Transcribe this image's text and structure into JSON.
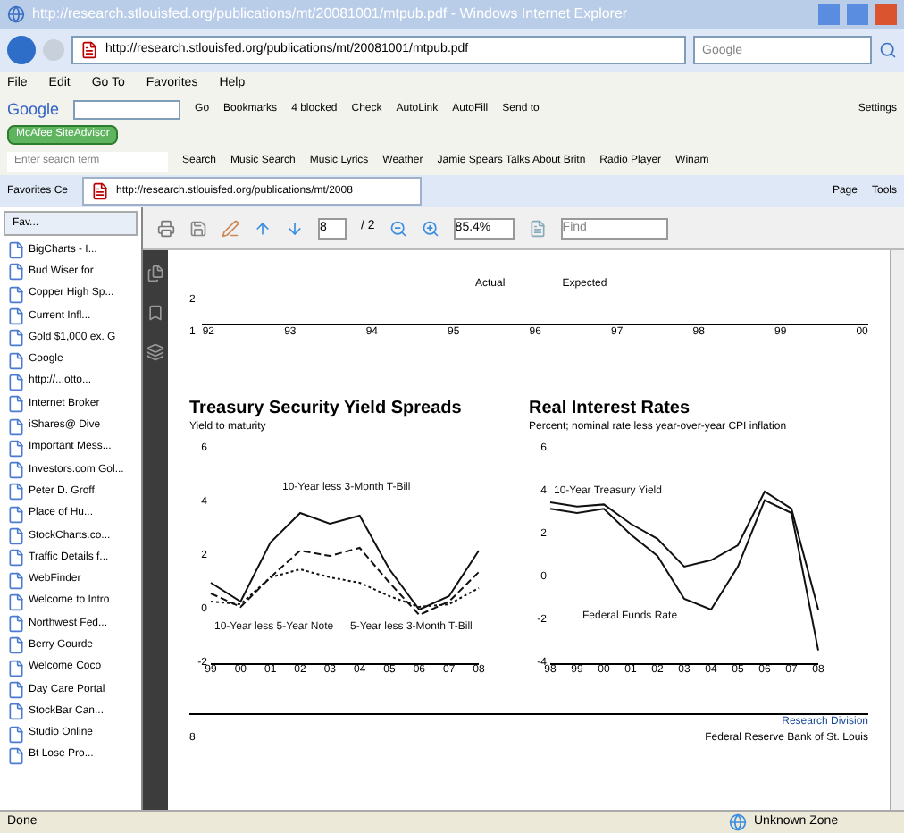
{
  "window": {
    "title": "http://research.stlouisfed.org/publications/mt/20081001/mtpub.pdf - Windows Internet Explorer"
  },
  "address_bar": {
    "url": "http://research.stlouisfed.org/publications/mt/20081001/mtpub.pdf",
    "search_placeholder": "Google"
  },
  "menu": [
    "File",
    "Edit",
    "Go To",
    "Favorites",
    "Help"
  ],
  "google_toolbar": {
    "logo": "Google",
    "items": [
      "Go",
      "Bookmarks",
      "4 blocked",
      "Check",
      "AutoLink",
      "AutoFill",
      "Send to"
    ],
    "right": "Settings"
  },
  "mcafee_button": "McAfee SiteAdvisor",
  "links_toolbar": {
    "search_placeholder": "Enter search term",
    "items": [
      "Search",
      "Music Search",
      "Music Lyrics",
      "Weather",
      "Jamie Spears Talks About Britn",
      "Radio Player"
    ],
    "more": "Winam"
  },
  "tab_bar": {
    "favorites_center": "Favorites Ce",
    "tab_title": "http://research.stlouisfed.org/publications/mt/2008",
    "commands": [
      "Page",
      "Tools"
    ]
  },
  "favorites_pane": {
    "tab": "Fav...",
    "items": [
      "BigCharts - I...",
      "Bud Wiser for",
      "Copper High Sp...",
      "Current Infl...",
      "Gold $1,000 ex. G",
      "Google",
      "http://...otto...",
      "Internet Broker",
      "iShares@ Dive",
      "Important Mess...",
      "Investors.com Gol...",
      "Peter D. Groff",
      "Place of Hu...",
      "StockCharts.co...",
      "Traffic Details f...",
      "WebFinder",
      "Welcome to Intro",
      "Northwest Fed...",
      "Berry Gourde",
      "Welcome Coco",
      "Day Care Portal",
      "StockBar Can...",
      "Studio Online",
      "Bt Lose Pro..."
    ]
  },
  "pdf_toolbar": {
    "page": "8",
    "of": "/ 2",
    "zoom": "85.4%",
    "find_placeholder": "Find"
  },
  "top_chart": {
    "labels": [
      "Actual",
      "Expected"
    ],
    "yticks": [
      "2",
      "1"
    ],
    "xticks": [
      "92",
      "93",
      "94",
      "95",
      "96",
      "97",
      "98",
      "99",
      "00"
    ]
  },
  "charts": [
    {
      "subtitle": "Yield to maturity",
      "chart_data": {
        "type": "line",
        "title": "Treasury Security Yield Spreads",
        "categories": [
          "99",
          "00",
          "01",
          "02",
          "03",
          "04",
          "05",
          "06",
          "07",
          "08"
        ],
        "ylim": [
          -2,
          6
        ],
        "yticks": [
          6,
          4,
          2,
          0,
          -2
        ],
        "series": [
          {
            "name": "10-Year less 3-Month T-Bill",
            "color": "#111111",
            "line_style": "solid",
            "values": [
              1.0,
              0.3,
              2.5,
              3.6,
              3.2,
              3.5,
              1.5,
              0.0,
              0.5,
              2.2
            ]
          },
          {
            "name": "10-Year less 5-Year Note",
            "color": "#111111",
            "line_style": "dotted",
            "values": [
              0.3,
              0.2,
              1.2,
              1.5,
              1.2,
              1.0,
              0.5,
              0.1,
              0.2,
              0.8
            ]
          },
          {
            "name": "5-Year less 3-Month T-Bill",
            "color": "#111111",
            "line_style": "dashed",
            "values": [
              0.6,
              0.1,
              1.2,
              2.2,
              2.0,
              2.3,
              1.0,
              -0.2,
              0.3,
              1.4
            ]
          }
        ]
      }
    },
    {
      "subtitle": "Percent; nominal rate less year-over-year CPI inflation",
      "chart_data": {
        "type": "line",
        "title": "Real Interest Rates",
        "categories": [
          "98",
          "99",
          "00",
          "01",
          "02",
          "03",
          "04",
          "05",
          "06",
          "07",
          "08"
        ],
        "ylim": [
          -4,
          6
        ],
        "yticks": [
          6,
          4,
          2,
          0,
          -2,
          -4
        ],
        "series": [
          {
            "name": "10-Year Treasury Yield",
            "color": "#111111",
            "line_style": "solid",
            "values": [
              3.5,
              3.3,
              3.4,
              2.5,
              1.8,
              0.5,
              0.8,
              1.5,
              4.0,
              3.2,
              -1.5
            ]
          },
          {
            "name": "Federal Funds Rate",
            "color": "#111111",
            "line_style": "solid",
            "values": [
              3.2,
              3.0,
              3.2,
              2.0,
              1.0,
              -1.0,
              -1.5,
              0.5,
              3.6,
              3.0,
              -3.4
            ]
          }
        ]
      }
    }
  ],
  "page_footer": {
    "number": "8",
    "division": "Research Division",
    "note": "Federal Reserve Bank of St. Louis"
  },
  "status_bar": {
    "text": "Done",
    "zone": "Unknown Zone"
  }
}
